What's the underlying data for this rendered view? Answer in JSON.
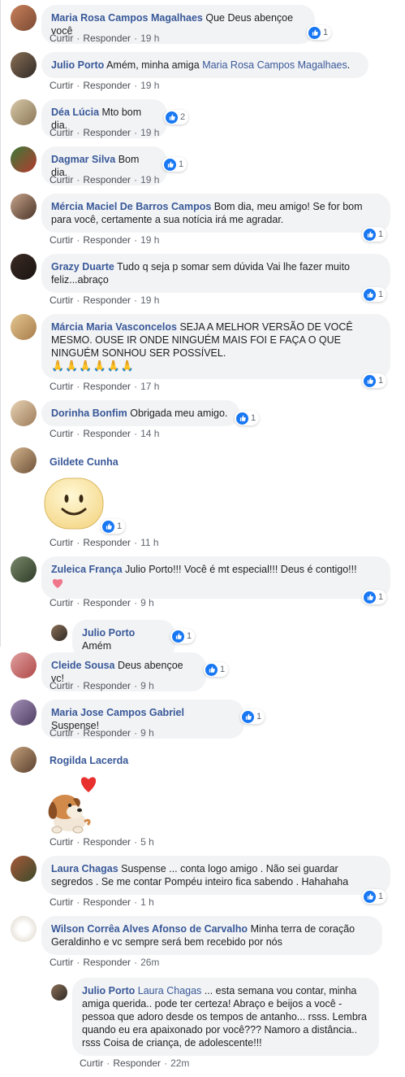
{
  "actions": {
    "like": "Curtir",
    "reply": "Responder"
  },
  "comments": [
    {
      "author": "Maria Rosa Campos Magalhaes",
      "text": "Que Deus abençoe você",
      "time": "19 h",
      "reactions": "1"
    },
    {
      "author": "Julio Porto",
      "text": "Amém, minha amiga ",
      "mention": "Maria Rosa Campos Magalhaes",
      "after": ".",
      "time": "19 h"
    },
    {
      "author": "Déa Lúcia",
      "text": "Mto bom dia.",
      "time": "19 h",
      "reactions": "2"
    },
    {
      "author": "Dagmar Silva",
      "text": "Bom dia.",
      "time": "19 h",
      "reactions": "1"
    },
    {
      "author": "Mércia Maciel De Barros Campos",
      "text": "Bom dia, meu amigo! Se for bom para você, certamente a sua notícia irá me agradar.",
      "time": "19 h",
      "reactions": "1"
    },
    {
      "author": "Grazy Duarte",
      "text": "Tudo q seja p somar sem dúvida Vai lhe fazer muito feliz...abraço",
      "time": "19 h",
      "reactions": "1"
    },
    {
      "author": "Márcia Maria Vasconcelos",
      "text": "SEJA A MELHOR VERSÃO DE VOCÊ MESMO. OUSE IR ONDE NINGUÉM MAIS FOI E FAÇA O QUE NINGUÉM SONHOU SER POSSÍVEL.",
      "emoji": "🙏🙏🙏🙏🙏🙏",
      "time": "17 h",
      "reactions": "1"
    },
    {
      "author": "Dorinha Bonfim",
      "text": "Obrigada meu amigo.",
      "time": "14 h",
      "reactions": "1"
    },
    {
      "author": "Gildete Cunha",
      "time": "11 h",
      "reactions": "1"
    },
    {
      "author": "Zuleica França",
      "text": "Julio Porto!!! Você é mt especial!!! Deus é contigo!!!",
      "time": "9 h",
      "reactions": "1"
    },
    {
      "author": "Julio Porto",
      "text": "Amém",
      "reactions": "1"
    },
    {
      "author": "Cleide Sousa",
      "text": "Deus abençoe vc!",
      "time": "9 h",
      "reactions": "1"
    },
    {
      "author": "Maria Jose Campos Gabriel",
      "text": "Suspense!",
      "time": "9 h",
      "reactions": "1"
    },
    {
      "author": "Rogilda Lacerda",
      "time": "5 h"
    },
    {
      "author": "Laura Chagas",
      "text": "Suspense ... conta logo amigo . Não sei guardar segredos . Se me contar Pompéu inteiro fica sabendo . Hahahaha",
      "time": "1 h",
      "reactions": "1"
    },
    {
      "author": "Wilson Corrêa Alves Afonso de Carvalho",
      "text": "Minha terra de coração Geraldinho e vc sempre será bem recebido por nós",
      "time": "26m"
    },
    {
      "author": "Julio Porto",
      "mention": "Laura Chagas",
      "text": " ... esta semana vou contar, minha amiga querida.. pode ter certeza! Abraço e beijos a você - pessoa que adoro desde os tempos de antanho... rsss. Lembra quando eu era apaixonado por você??? Namoro a distância.. rsss Coisa de criança, de adolescente!!!",
      "time": "22m"
    }
  ]
}
